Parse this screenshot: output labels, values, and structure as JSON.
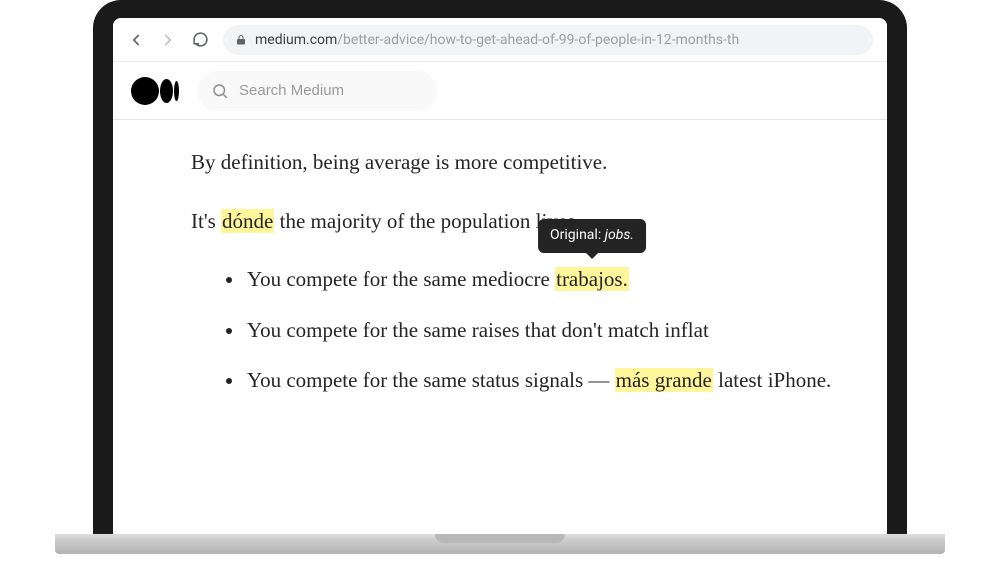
{
  "browser": {
    "url_host": "medium.com",
    "url_path": "/better-advice/how-to-get-ahead-of-99-of-people-in-12-months-th"
  },
  "medium": {
    "search_placeholder": "Search Medium"
  },
  "article": {
    "p1": "By definition, being average is more competitive.",
    "p2_a": "It's ",
    "p2_hl": "dónde",
    "p2_b": " the majority of the population lives.",
    "bullets": [
      {
        "a": "You compete for the same mediocre ",
        "hl": "trabajos.",
        "b": "",
        "tooltip_label": "Original: ",
        "tooltip_value": "jobs."
      },
      {
        "a": "You compete for the same raises that don't match inflat",
        "hl": "",
        "b": ""
      },
      {
        "a": "You compete for the same status signals — ",
        "hl": "más grande",
        "b": " latest iPhone."
      }
    ]
  }
}
